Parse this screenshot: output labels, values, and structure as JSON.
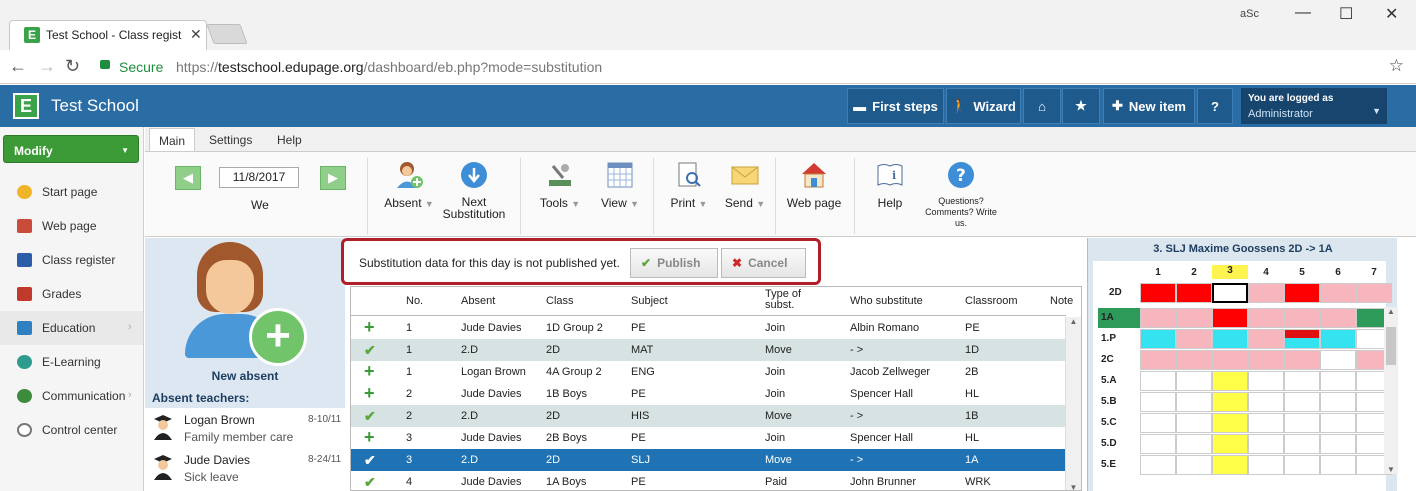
{
  "browser": {
    "tab_title": "Test School - Class regist",
    "tab_close": "✕",
    "favicon": "E",
    "ext_label": "aSc",
    "secure_label": "Secure",
    "url_prefix": "https://",
    "url_host": "testschool.edupage.org",
    "url_path": "/dashboard/eb.php?mode=substitution"
  },
  "app": {
    "logo": "E",
    "school_name": "Test School",
    "toolbar": {
      "first_steps": "First steps",
      "wizard": "Wizard",
      "new_item": "New item",
      "help": "?"
    },
    "logged_in_label": "You are logged as",
    "logged_in_user": "Administrator"
  },
  "sidebar": {
    "modify_label": "Modify",
    "items": [
      {
        "label": "Start page",
        "icon": "star-icon",
        "color": "#f0b429"
      },
      {
        "label": "Web page",
        "icon": "web-icon",
        "color": "#c94c3b"
      },
      {
        "label": "Class register",
        "icon": "book-icon",
        "color": "#2a5ea8"
      },
      {
        "label": "Grades",
        "icon": "grades-icon",
        "color": "#c0392b"
      },
      {
        "label": "Education",
        "icon": "education-icon",
        "color": "#2f7fc1"
      },
      {
        "label": "E-Learning",
        "icon": "elearning-icon",
        "color": "#2d9c8f"
      },
      {
        "label": "Communication",
        "icon": "communication-icon",
        "color": "#3d8b3d"
      },
      {
        "label": "Control center",
        "icon": "gear-icon",
        "color": "#777777"
      }
    ]
  },
  "ribbon": {
    "tabs": [
      "Main",
      "Settings",
      "Help"
    ],
    "date": "11/8/2017",
    "day": "We",
    "buttons": {
      "absent": "Absent",
      "next_sub_1": "Next",
      "next_sub_2": "Substitution",
      "tools": "Tools",
      "view": "View",
      "print": "Print",
      "send": "Send",
      "web_page": "Web page",
      "help": "Help",
      "questions_1": "Questions?",
      "questions_2": "Comments? Write",
      "questions_3": "us."
    }
  },
  "absent_panel": {
    "new_absent": "New absent",
    "title": "Absent teachers:",
    "teachers": [
      {
        "name": "Logan Brown",
        "reason": "Family member care",
        "dates": "8-10/11"
      },
      {
        "name": "Jude Davies",
        "reason": "Sick leave",
        "dates": "8-24/11"
      }
    ]
  },
  "notice": {
    "text": "Substitution data for this day is not published yet.",
    "publish": "Publish",
    "cancel": "Cancel"
  },
  "grid": {
    "headers": {
      "no": "No.",
      "absent": "Absent",
      "class": "Class",
      "subject": "Subject",
      "type1": "Type of",
      "type2": "subst.",
      "who": "Who substitute",
      "room": "Classroom",
      "note": "Note"
    },
    "rows": [
      {
        "icon": "+",
        "no": "1",
        "absent": "Jude Davies",
        "class": "1D Group 2",
        "subject": "PE",
        "type": "Join",
        "who": "Albin Romano",
        "room": "PE",
        "style": "add"
      },
      {
        "icon": "✔",
        "no": "1",
        "absent": "2.D",
        "class": "2D",
        "subject": "MAT",
        "type": "Move",
        "who": "- >",
        "room": "1D",
        "style": "mov"
      },
      {
        "icon": "+",
        "no": "1",
        "absent": "Logan Brown",
        "class": "4A Group 2",
        "subject": "ENG",
        "type": "Join",
        "who": "Jacob Zellweger",
        "room": "2B",
        "style": "add"
      },
      {
        "icon": "+",
        "no": "2",
        "absent": "Jude Davies",
        "class": "1B Boys",
        "subject": "PE",
        "type": "Join",
        "who": "Spencer Hall",
        "room": "HL",
        "style": "add"
      },
      {
        "icon": "✔",
        "no": "2",
        "absent": "2.D",
        "class": "2D",
        "subject": "HIS",
        "type": "Move",
        "who": "- >",
        "room": "1B",
        "style": "mov"
      },
      {
        "icon": "+",
        "no": "3",
        "absent": "Jude Davies",
        "class": "2B Boys",
        "subject": "PE",
        "type": "Join",
        "who": "Spencer Hall",
        "room": "HL",
        "style": "add"
      },
      {
        "icon": "✔",
        "no": "3",
        "absent": "2.D",
        "class": "2D",
        "subject": "SLJ",
        "type": "Move",
        "who": "- >",
        "room": "1A",
        "style": "sel"
      },
      {
        "icon": "✔",
        "no": "4",
        "absent": "Jude Davies",
        "class": "1A Boys",
        "subject": "PE",
        "type": "Paid",
        "who": "John Brunner",
        "room": "WRK",
        "style": "add"
      }
    ]
  },
  "right_panel": {
    "title": "3. SLJ Maxime Goossens 2D -> 1A",
    "periods": [
      "1",
      "2",
      "3",
      "4",
      "5",
      "6",
      "7"
    ],
    "rows": [
      "2D",
      "1A",
      "1.P",
      "2C",
      "5.A",
      "5.B",
      "5.C",
      "5.D",
      "5.E"
    ]
  }
}
